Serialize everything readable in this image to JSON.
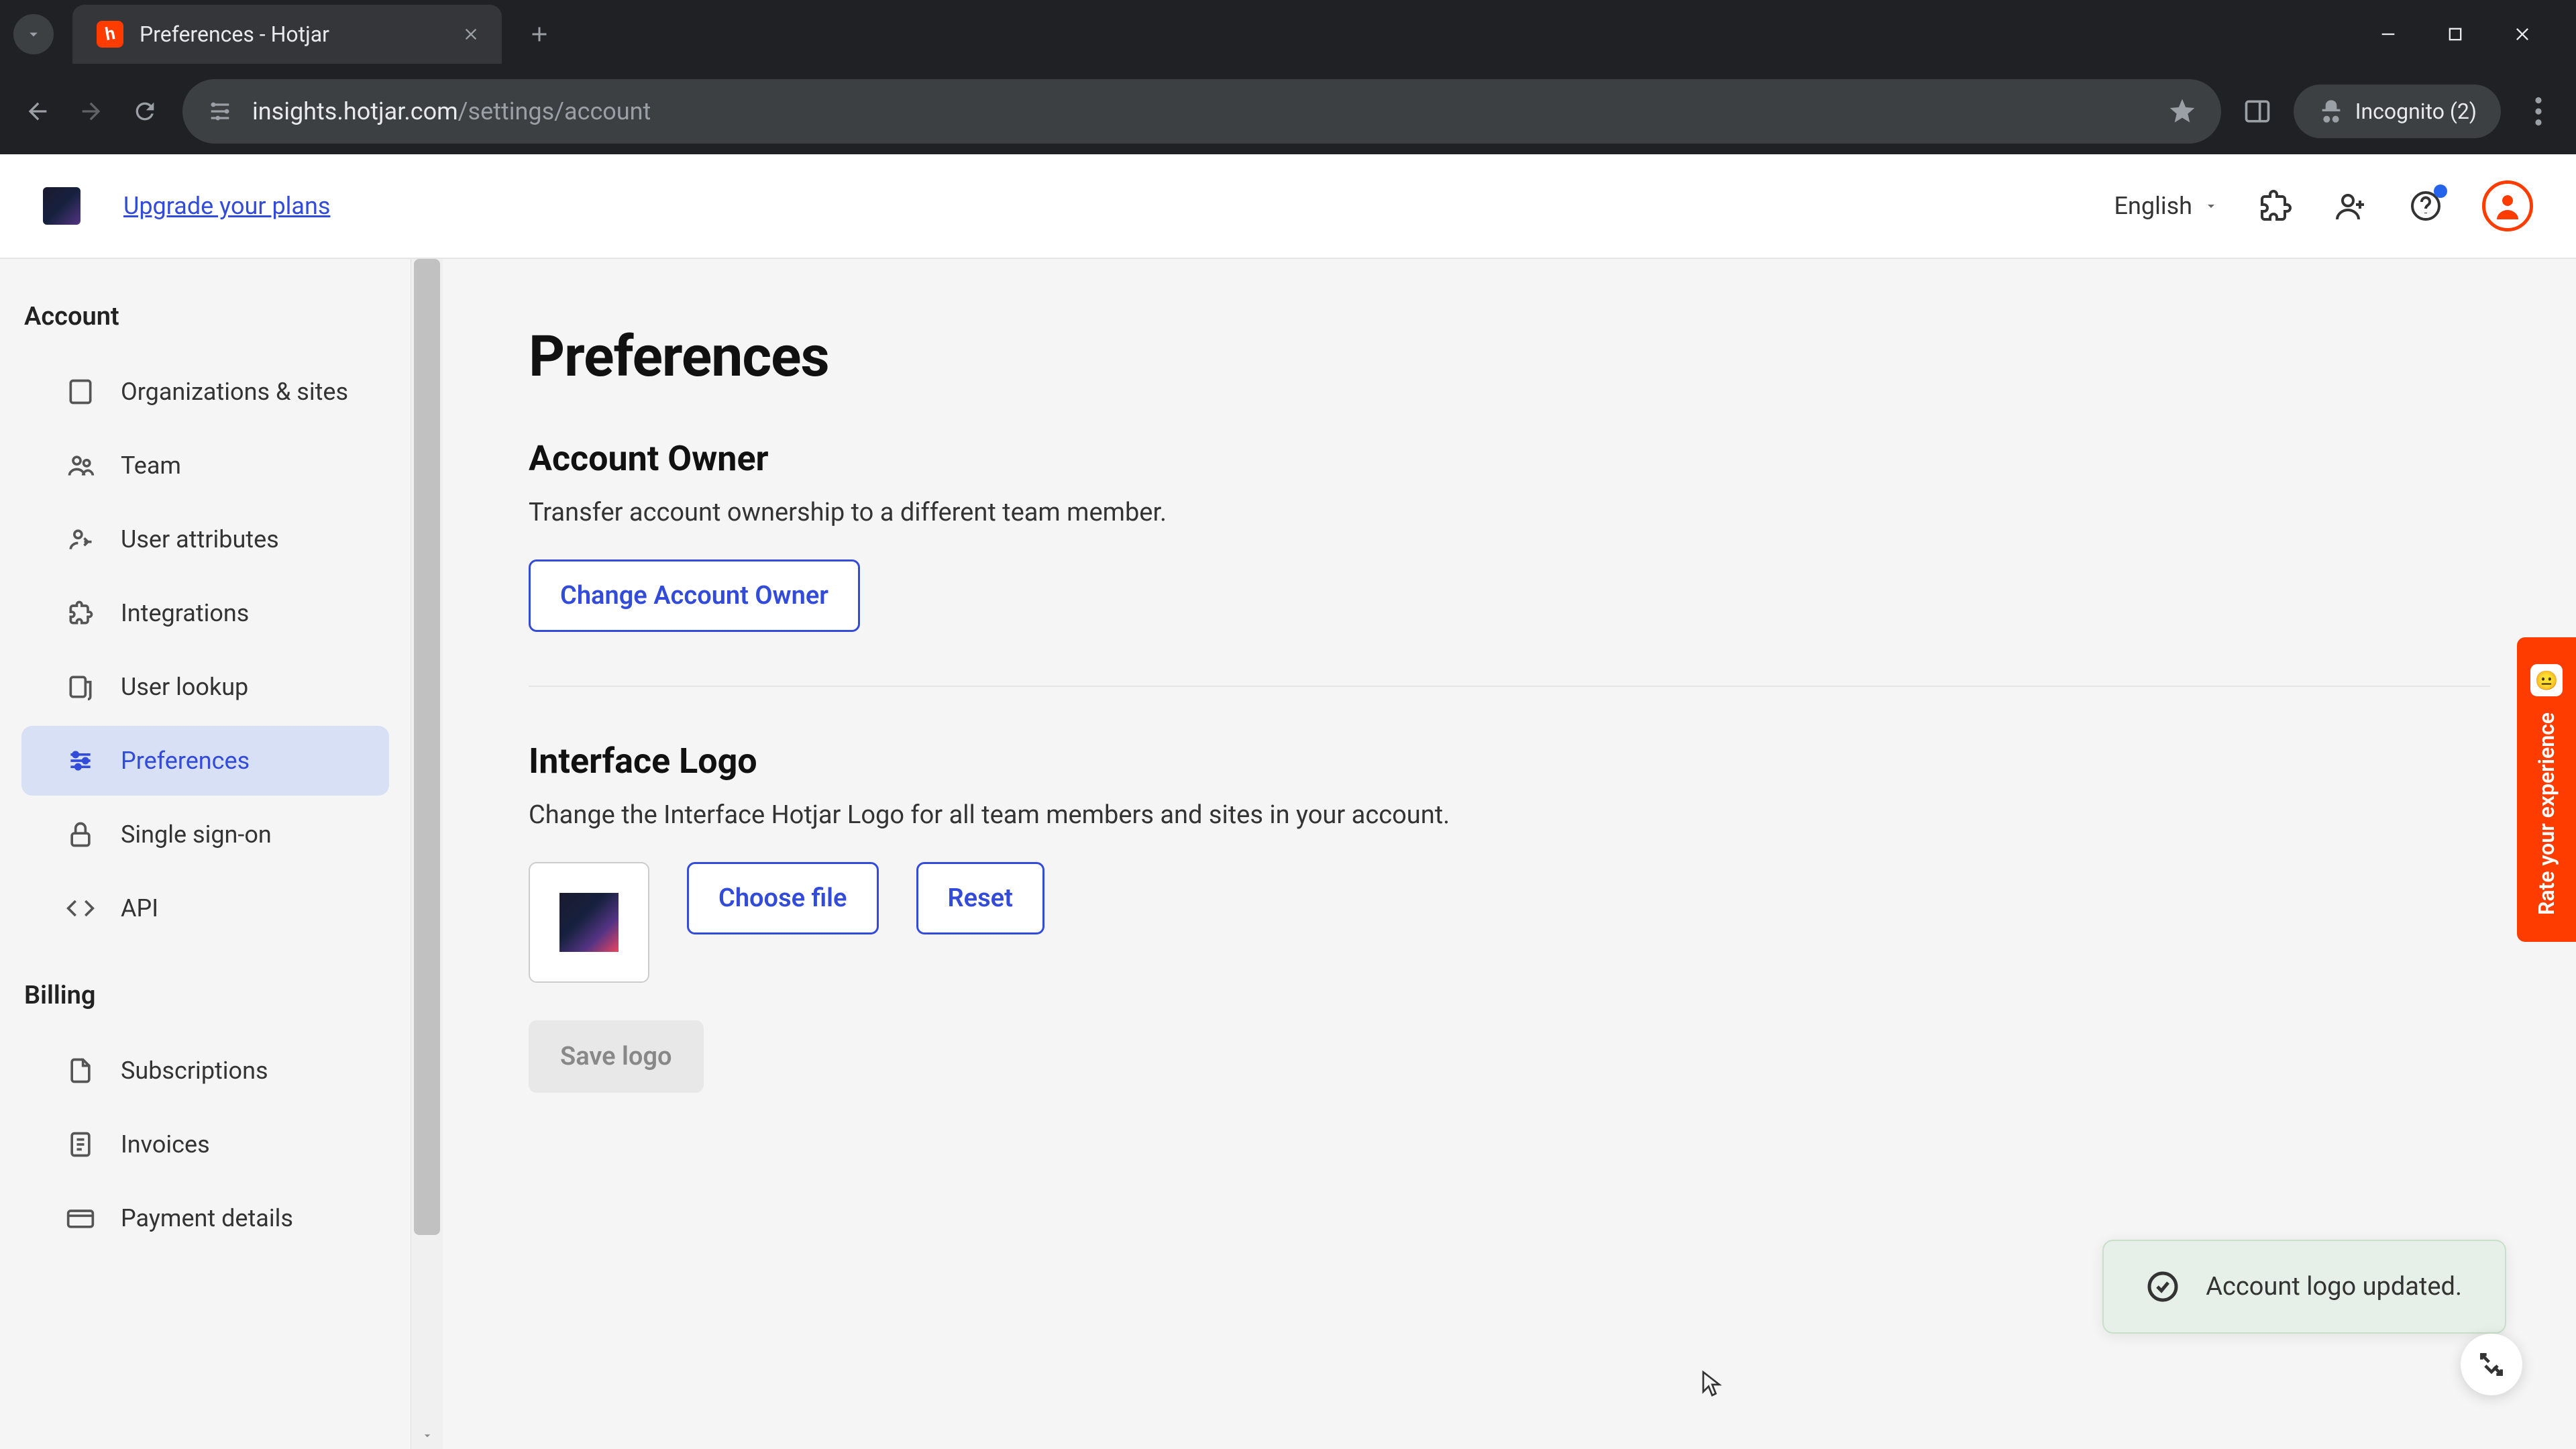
{
  "browser": {
    "tab_title": "Preferences - Hotjar",
    "url_domain": "insights.hotjar.com",
    "url_path": "/settings/account",
    "incognito_label": "Incognito (2)"
  },
  "header": {
    "upgrade_label": "Upgrade your plans",
    "language": "English"
  },
  "sidebar": {
    "groups": [
      {
        "heading": "Account",
        "items": [
          {
            "label": "Organizations & sites",
            "icon": "building-icon",
            "active": false
          },
          {
            "label": "Team",
            "icon": "team-icon",
            "active": false
          },
          {
            "label": "User attributes",
            "icon": "user-attr-icon",
            "active": false
          },
          {
            "label": "Integrations",
            "icon": "puzzle-icon",
            "active": false
          },
          {
            "label": "User lookup",
            "icon": "lookup-icon",
            "active": false
          },
          {
            "label": "Preferences",
            "icon": "sliders-icon",
            "active": true
          },
          {
            "label": "Single sign-on",
            "icon": "lock-icon",
            "active": false
          },
          {
            "label": "API",
            "icon": "code-icon",
            "active": false
          }
        ]
      },
      {
        "heading": "Billing",
        "items": [
          {
            "label": "Subscriptions",
            "icon": "file-icon",
            "active": false
          },
          {
            "label": "Invoices",
            "icon": "receipt-icon",
            "active": false
          },
          {
            "label": "Payment details",
            "icon": "card-icon",
            "active": false
          }
        ]
      }
    ]
  },
  "main": {
    "page_title": "Preferences",
    "sections": {
      "account_owner": {
        "heading": "Account Owner",
        "desc": "Transfer account ownership to a different team member.",
        "button": "Change Account Owner"
      },
      "interface_logo": {
        "heading": "Interface Logo",
        "desc": "Change the Interface Hotjar Logo for all team members and sites in your account.",
        "choose": "Choose file",
        "reset": "Reset",
        "save": "Save logo"
      }
    }
  },
  "toast": {
    "message": "Account logo updated."
  },
  "feedback": {
    "label": "Rate your experience",
    "emoji": "😐"
  }
}
